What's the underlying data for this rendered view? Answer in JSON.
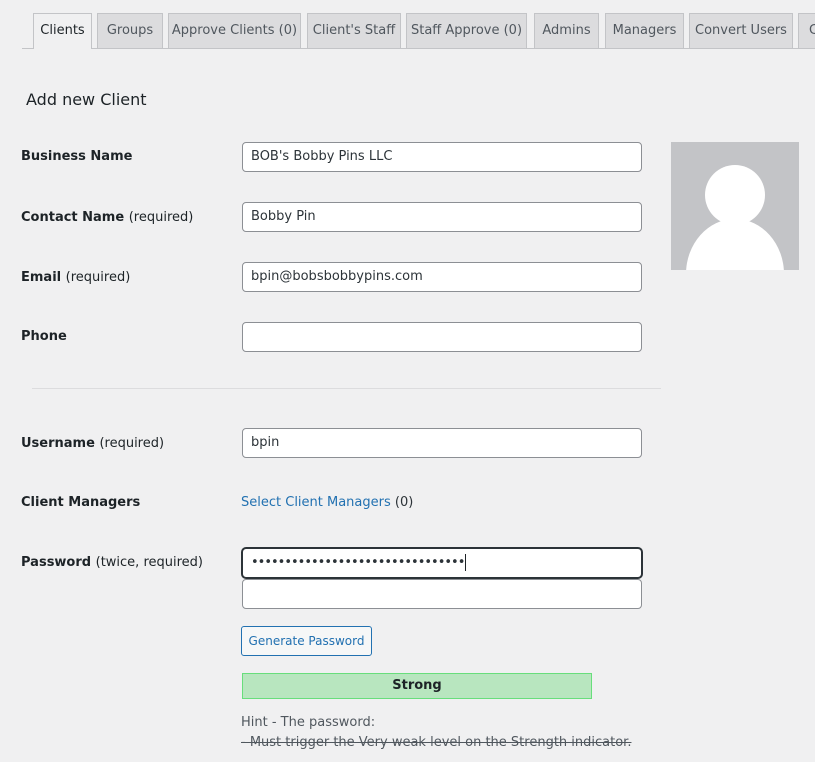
{
  "tabs": [
    {
      "label": "Clients",
      "active": true
    },
    {
      "label": "Groups"
    },
    {
      "label": "Approve Clients (0)"
    },
    {
      "label": "Client's Staff"
    },
    {
      "label": "Staff Approve (0)"
    },
    {
      "label": "Admins"
    },
    {
      "label": "Managers"
    },
    {
      "label": "Convert Users"
    },
    {
      "label": "C"
    }
  ],
  "page": {
    "title": "Add new Client"
  },
  "form": {
    "business_name": {
      "label": "Business Name",
      "value": "BOB's Bobby Pins LLC"
    },
    "contact_name": {
      "label": "Contact Name",
      "req": "(required)",
      "value": "Bobby Pin"
    },
    "email": {
      "label": "Email",
      "req": "(required)",
      "value": "bpin@bobsbobbypins.com"
    },
    "phone": {
      "label": "Phone",
      "value": ""
    },
    "username": {
      "label": "Username",
      "req": "(required)",
      "value": "bpin"
    },
    "client_managers": {
      "label": "Client Managers",
      "link": "Select Client Managers",
      "count": "(0)"
    },
    "password": {
      "label": "Password",
      "req": "(twice, required)",
      "value": "••••••••••••••••••••••••••••••••",
      "confirm_value": ""
    },
    "generate_button": "Generate Password",
    "strength": "Strong",
    "hint_title": "Hint - The password:",
    "hint_rule": "- Must trigger the Very weak level on the Strength indicator."
  },
  "colors": {
    "link": "#2271b1",
    "strength_bg": "#b8e6bf",
    "avatar_bg": "#c3c4c7"
  },
  "icons": {
    "avatar": "person-silhouette-icon"
  }
}
